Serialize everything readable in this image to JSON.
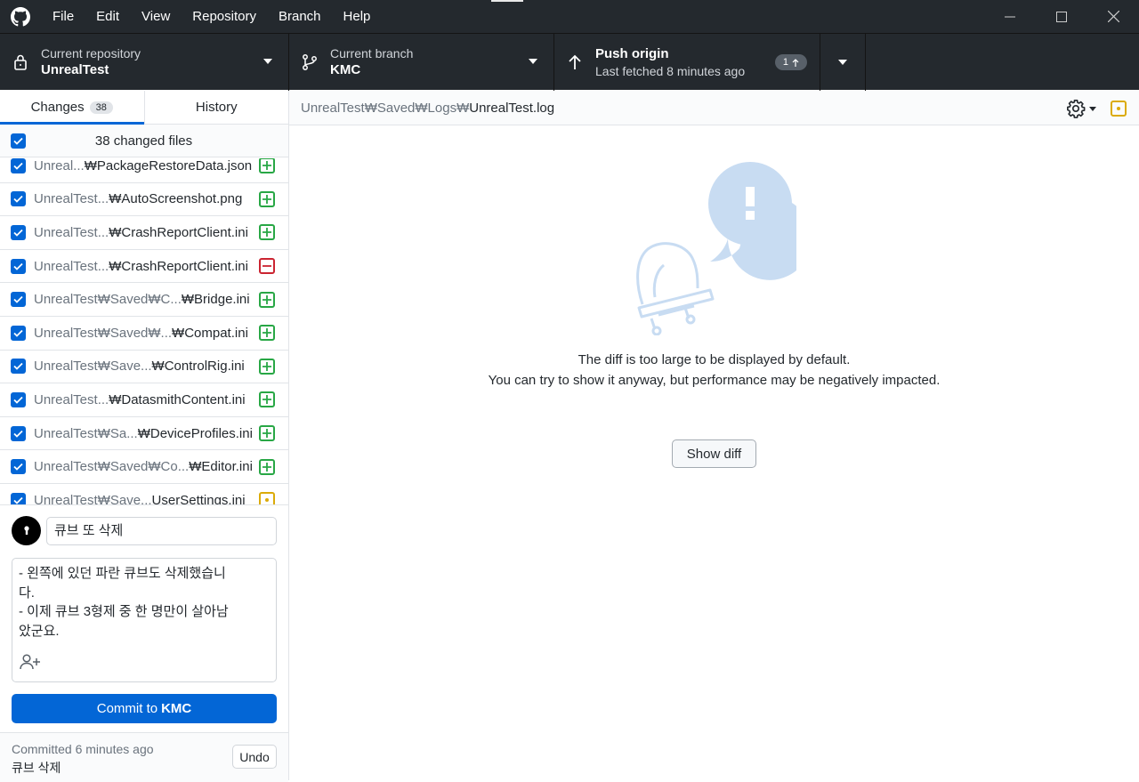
{
  "menu": [
    "File",
    "Edit",
    "View",
    "Repository",
    "Branch",
    "Help"
  ],
  "toolbar": {
    "repo_label": "Current repository",
    "repo_value": "UnrealTest",
    "branch_label": "Current branch",
    "branch_value": "KMC",
    "push_label": "Push origin",
    "push_sub": "Last fetched 8 minutes ago",
    "push_count": "1"
  },
  "sidebar": {
    "tab_changes": "Changes",
    "tab_changes_count": "38",
    "tab_history": "History",
    "changed_files_label": "38 changed files",
    "files": [
      {
        "dim": "Unreal...",
        "name": "₩PackageRestoreData.json",
        "status": "added"
      },
      {
        "dim": "UnrealTest...",
        "name": "₩AutoScreenshot.png",
        "status": "added"
      },
      {
        "dim": "UnrealTest...",
        "name": "₩CrashReportClient.ini",
        "status": "added"
      },
      {
        "dim": "UnrealTest...",
        "name": "₩CrashReportClient.ini",
        "status": "removed"
      },
      {
        "dim": "UnrealTest₩Saved₩C...",
        "name": "₩Bridge.ini",
        "status": "added"
      },
      {
        "dim": "UnrealTest₩Saved₩...",
        "name": "₩Compat.ini",
        "status": "added"
      },
      {
        "dim": "UnrealTest₩Save...",
        "name": "₩ControlRig.ini",
        "status": "added"
      },
      {
        "dim": "UnrealTest...",
        "name": "₩DatasmithContent.ini",
        "status": "added"
      },
      {
        "dim": "UnrealTest₩Sa...",
        "name": "₩DeviceProfiles.ini",
        "status": "added"
      },
      {
        "dim": "UnrealTest₩Saved₩Co...",
        "name": "₩Editor.ini",
        "status": "added"
      },
      {
        "dim": "UnrealTest₩Save...",
        "name": "UserSettings.ini",
        "status": "modified"
      }
    ]
  },
  "commit": {
    "summary": "큐브 또 삭제",
    "description": "- 왼쪽에 있던 파란 큐브도 삭제했습니\n다.\n- 이제 큐브 3형제 중 한 명만이 살아남\n았군요.",
    "button_prefix": "Commit to",
    "button_branch": "KMC"
  },
  "last_commit": {
    "time": "Committed 6 minutes ago",
    "message": "큐브 삭제",
    "undo": "Undo"
  },
  "main": {
    "path_dim": "UnrealTest₩Saved₩Logs₩",
    "path_file": "UnrealTest.log",
    "message_line1": "The diff is too large to be displayed by default.",
    "message_line2": "You can try to show it anyway, but performance may be negatively impacted.",
    "show_diff": "Show diff"
  },
  "colors": {
    "toolbar_bg": "#24292e",
    "accent": "#0366d6",
    "added": "#28a745",
    "removed": "#cb2431",
    "modified": "#dbab09"
  }
}
